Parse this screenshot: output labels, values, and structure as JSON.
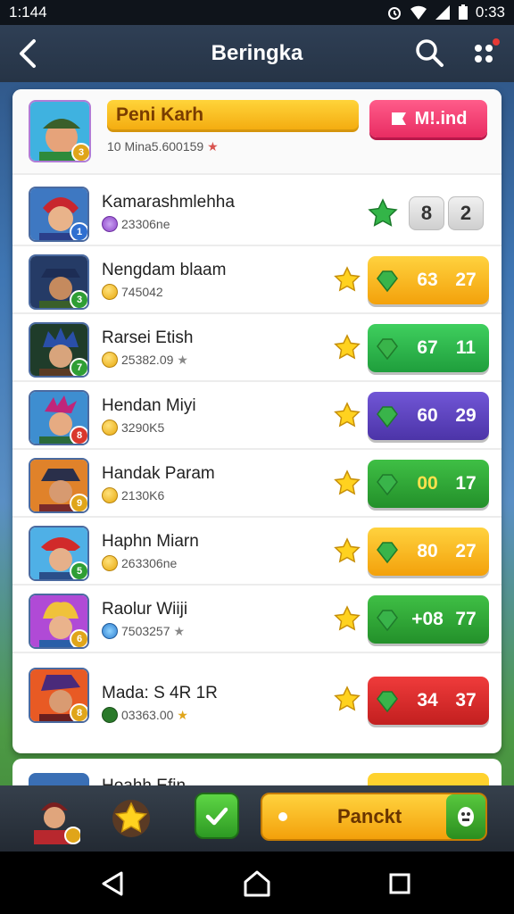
{
  "status": {
    "time": "1:144",
    "clock": "0:33"
  },
  "header": {
    "title": "Beringka"
  },
  "me": {
    "name": "Peni Karh",
    "sub": "10 Mina5.600159",
    "action_label": "M!.ind",
    "level": "3"
  },
  "leaderboard": [
    {
      "name": "Kamarashmlehha",
      "sub": "23306ne",
      "v1": "8",
      "v2": "2",
      "pill": "grey",
      "level": "1"
    },
    {
      "name": "Nengdam blaam",
      "sub": "745042",
      "v1": "63",
      "v2": "27",
      "pill": "#f5b21b",
      "level": "3"
    },
    {
      "name": "Rarsei Etish",
      "sub": "25382.09",
      "v1": "67",
      "v2": "11",
      "pill": "#2fae4a",
      "level": "7"
    },
    {
      "name": "Hendan Miyi",
      "sub": "3290K5",
      "v1": "60",
      "v2": "29",
      "pill": "#5b3fb8",
      "level": "8"
    },
    {
      "name": "Handak Param",
      "sub": "2130K6",
      "v1": "00",
      "v2": "17",
      "pill": "#2f9e34",
      "level": "9"
    },
    {
      "name": "Haphn Miarn",
      "sub": "263306ne",
      "v1": "80",
      "v2": "27",
      "pill": "#f5b21b",
      "level": "5"
    },
    {
      "name": "Raolur Wiiji",
      "sub": "7503257",
      "v1": "+08",
      "v2": "77",
      "pill": "#2f9e34",
      "level": "6"
    },
    {
      "name": "Mada: S 4R 1R",
      "sub": "03363.00",
      "v1": "34",
      "v2": "37",
      "pill": "#d92b2b",
      "level": "8"
    }
  ],
  "peek": {
    "name": "Hoahh Efin"
  },
  "bottom": {
    "cta_label": "Panckt",
    "avatar_level": "1"
  }
}
